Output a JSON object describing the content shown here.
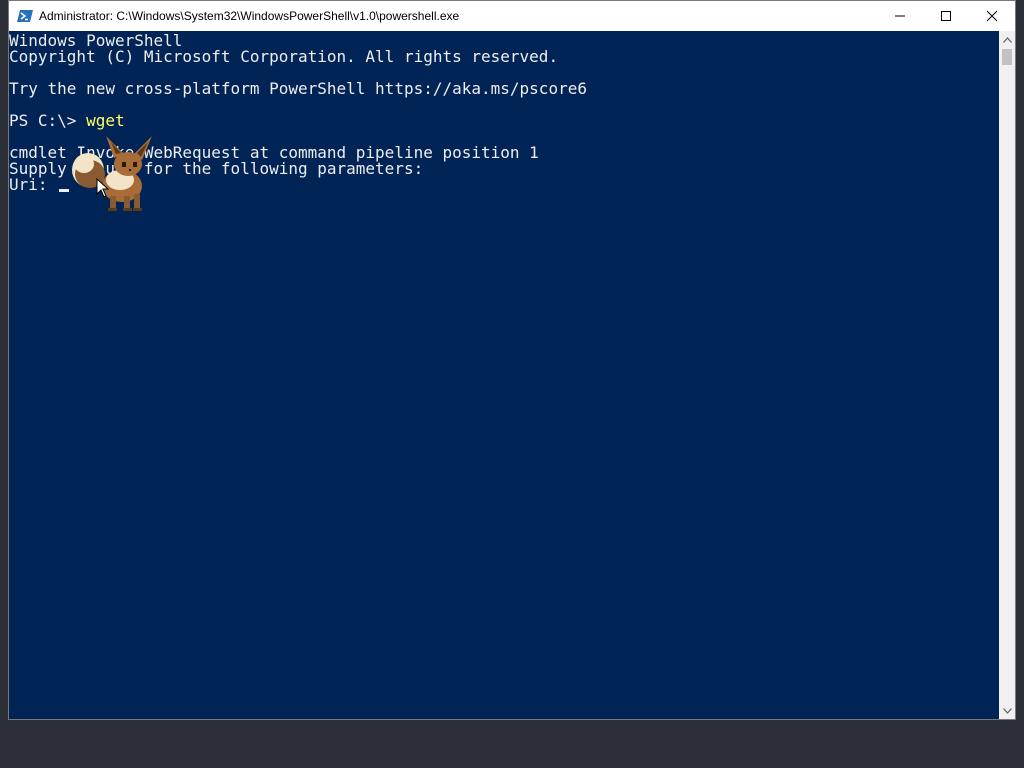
{
  "window": {
    "title": "Administrator: C:\\Windows\\System32\\WindowsPowerShell\\v1.0\\powershell.exe",
    "icon": "powershell-icon",
    "controls": {
      "minimize": "minimize-icon",
      "maximize": "maximize-icon",
      "close": "close-icon"
    }
  },
  "console": {
    "line1": "Windows PowerShell",
    "line2": "Copyright (C) Microsoft Corporation. All rights reserved.",
    "line3": "",
    "line4": "Try the new cross-platform PowerShell https://aka.ms/pscore6",
    "line5": "",
    "prompt": "PS C:\\> ",
    "command": "wget",
    "line7": "",
    "line8": "cmdlet Invoke-WebRequest at command pipeline position 1",
    "line9": "Supply values for the following parameters:",
    "uri_label": "Uri: "
  },
  "colors": {
    "background": "#012456",
    "text": "#eeedf0",
    "command": "#ffff66"
  },
  "overlay": {
    "pet": "eevee-desktop-pet",
    "cursor": "arrow-cursor-icon"
  }
}
